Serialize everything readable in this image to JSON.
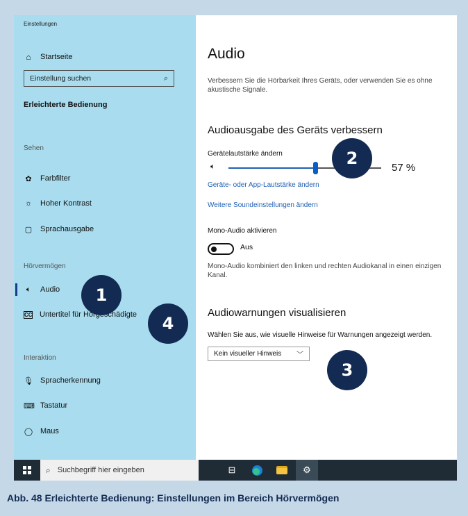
{
  "sidebar": {
    "app_title": "Einstellungen",
    "home_label": "Startseite",
    "search_placeholder": "Einstellung suchen",
    "section_title": "Erleichterte Bedienung",
    "group_sehen": "Sehen",
    "group_hoeren": "Hörvermögen",
    "group_interaktion": "Interaktion",
    "items": [
      {
        "label": "Farbfilter",
        "icon": "color-filter-icon"
      },
      {
        "label": "Hoher Kontrast",
        "icon": "contrast-icon"
      },
      {
        "label": "Sprachausgabe",
        "icon": "narrator-icon"
      },
      {
        "label": "Audio",
        "icon": "speaker-icon",
        "selected": true
      },
      {
        "label": "Untertitel für Hörgeschädigte",
        "icon": "captions-icon"
      },
      {
        "label": "Spracherkennung",
        "icon": "microphone-icon"
      },
      {
        "label": "Tastatur",
        "icon": "keyboard-icon"
      },
      {
        "label": "Maus",
        "icon": "mouse-icon"
      }
    ]
  },
  "main": {
    "title": "Audio",
    "description": "Verbessern Sie die Hörbarkeit Ihres Geräts, oder verwenden Sie es ohne akustische Signale.",
    "section1_title": "Audioausgabe des Geräts verbessern",
    "volume_label": "Gerätelautstärke ändern",
    "volume_value": 57,
    "volume_display": "57 %",
    "link_app_volume": "Geräte- oder App-Lautstärke ändern",
    "link_more_sound": "Weitere Soundeinstellungen ändern",
    "mono_label": "Mono-Audio aktivieren",
    "mono_state": "Aus",
    "mono_description": "Mono-Audio kombiniert den linken und rechten Audiokanal in einen einzigen Kanal.",
    "section2_title": "Audiowarnungen visualisieren",
    "visual_label": "Wählen Sie aus, wie visuelle Hinweise für Warnungen angezeigt werden.",
    "visual_selected": "Kein visueller Hinweis"
  },
  "taskbar": {
    "search_placeholder": "Suchbegriff hier eingeben"
  },
  "callouts": [
    "1",
    "2",
    "3",
    "4"
  ],
  "caption": "Abb. 48  Erleichterte Bedienung: Einstellungen im Bereich Hörvermögen",
  "colors": {
    "sidebar_bg": "#a8dcee",
    "accent": "#0b5fc4",
    "callout_bg": "#132b52",
    "frame_bg": "#c5d8e8"
  }
}
